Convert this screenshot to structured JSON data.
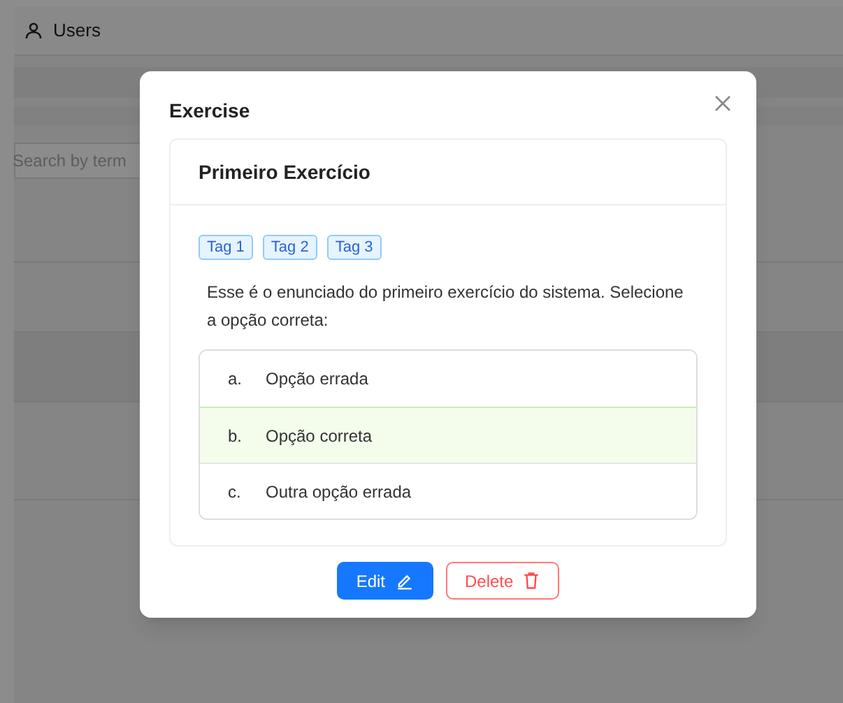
{
  "page": {
    "nav_item": "Users",
    "search": {
      "placeholder": "Search by term"
    }
  },
  "dialog": {
    "title": "Exercise",
    "card": {
      "title": "Primeiro Exercício",
      "tags": [
        "Tag 1",
        "Tag 2",
        "Tag 3"
      ],
      "statement": "Esse é o enunciado do primeiro exercício do sistema. Selecione a opção correta:",
      "options": [
        {
          "letter": "a.",
          "text": "Opção errada",
          "selected": false
        },
        {
          "letter": "b.",
          "text": "Opção correta",
          "selected": true
        },
        {
          "letter": "c.",
          "text": "Outra opção errada",
          "selected": false
        }
      ]
    },
    "buttons": [
      {
        "kind": "primary",
        "label": "Edit"
      },
      {
        "kind": "danger",
        "label": "Delete"
      }
    ]
  }
}
